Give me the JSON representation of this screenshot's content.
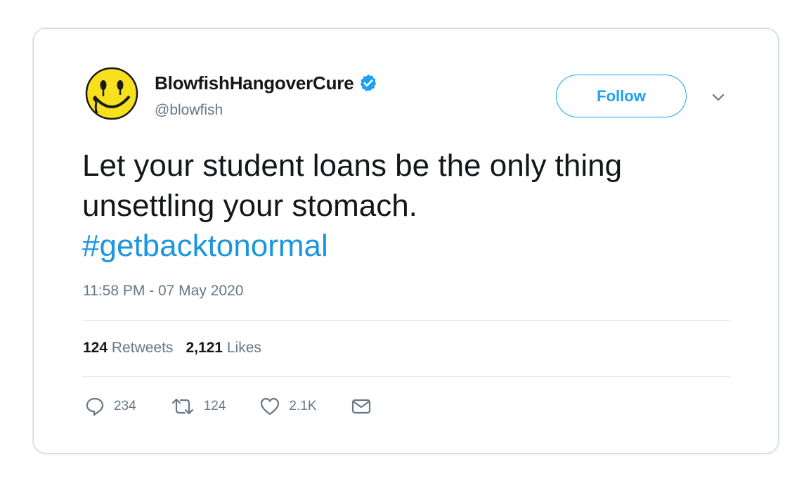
{
  "author": {
    "display_name": "BlowfishHangoverCure",
    "handle": "@blowfish",
    "verified": true,
    "avatar_icon": "smiley-face-icon"
  },
  "follow_label": "Follow",
  "tweet": {
    "text_line1": "Let your student loans be the only thing",
    "text_line2": "unsettling your stomach.",
    "hashtag": "#getbacktonormal",
    "timestamp": "11:58 PM - 07 May 2020"
  },
  "stats": {
    "retweets_count": "124",
    "retweets_label": "Retweets",
    "likes_count": "2,121",
    "likes_label": "Likes"
  },
  "actions": {
    "reply_count": "234",
    "retweet_count": "124",
    "like_count": "2.1K"
  },
  "colors": {
    "accent": "#1da1f2",
    "hashtag": "#1b95e0",
    "text": "#14171a",
    "muted": "#657786",
    "avatar_yellow": "#f7e11e"
  }
}
